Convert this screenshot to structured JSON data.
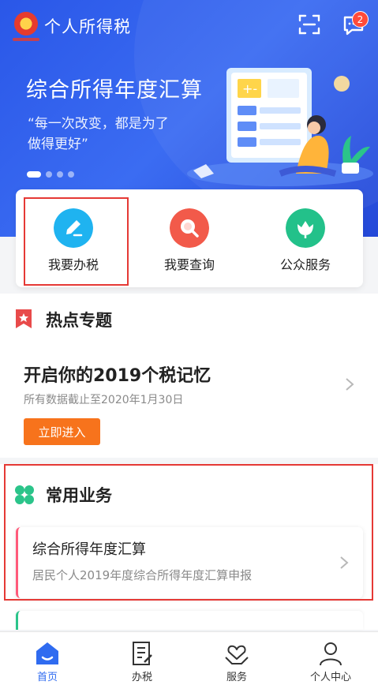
{
  "header": {
    "app_title": "个人所得税",
    "message_badge": "2",
    "icons": {
      "emblem": "tax-emblem-icon",
      "scan": "scan-icon",
      "message": "message-icon"
    }
  },
  "banner": {
    "title": "综合所得年度汇算",
    "subtitle_line1": "“每一次改变，都是为了",
    "subtitle_line2": "做得更好”",
    "page_count": 4,
    "active_page": 1
  },
  "quick_actions": [
    {
      "label": "我要办税",
      "icon": "edit-icon",
      "color": "#1fb3f0"
    },
    {
      "label": "我要查询",
      "icon": "search-icon",
      "color": "#f25a4a"
    },
    {
      "label": "公众服务",
      "icon": "service-flower-icon",
      "color": "#23c18a"
    }
  ],
  "hot_topics": {
    "section_title": "热点专题",
    "headline": "开启你的2019个税记忆",
    "note": "所有数据截止至2020年1月30日",
    "button_label": "立即进入"
  },
  "common_business": {
    "section_title": "常用业务",
    "items": [
      {
        "title": "综合所得年度汇算",
        "description": "居民个人2019年度综合所得年度汇算申报"
      }
    ]
  },
  "tabbar": {
    "items": [
      {
        "label": "首页",
        "icon": "home-icon",
        "active": true
      },
      {
        "label": "办税",
        "icon": "tax-doc-icon",
        "active": false
      },
      {
        "label": "服务",
        "icon": "heart-hands-icon",
        "active": false
      },
      {
        "label": "个人中心",
        "icon": "user-icon",
        "active": false
      }
    ]
  },
  "colors": {
    "primary": "#2f6bf0",
    "accent_orange": "#f7731c",
    "highlight_red": "#e53935"
  }
}
